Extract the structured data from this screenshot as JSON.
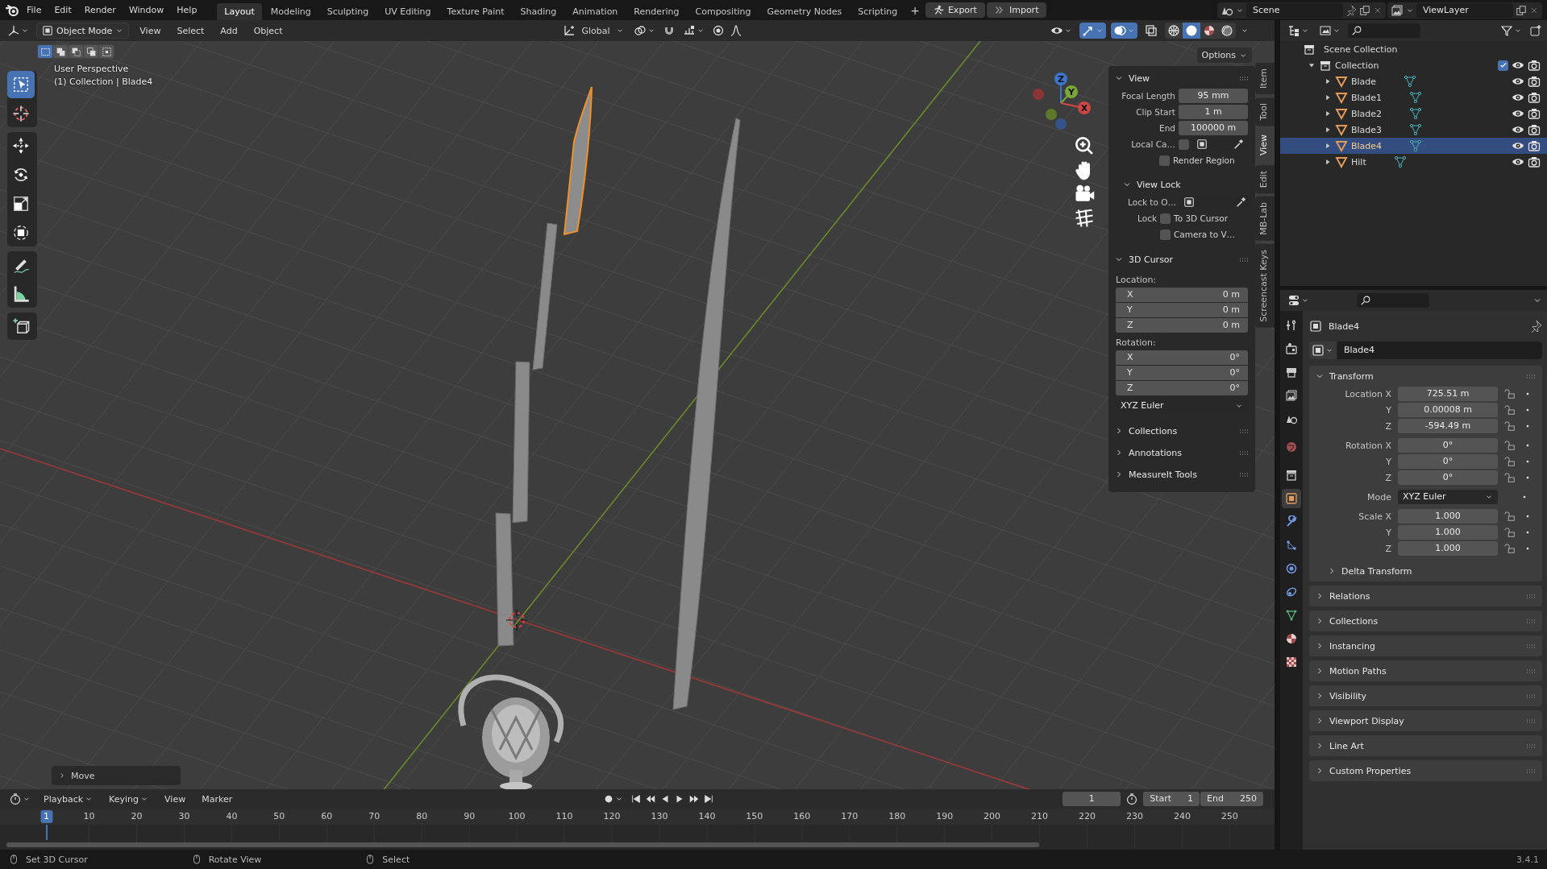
{
  "topbar": {
    "menus": [
      "File",
      "Edit",
      "Render",
      "Window",
      "Help"
    ],
    "workspaces": [
      {
        "label": "Layout",
        "selected": true
      },
      {
        "label": "Modeling",
        "selected": false
      },
      {
        "label": "Sculpting",
        "selected": false
      },
      {
        "label": "UV Editing",
        "selected": false
      },
      {
        "label": "Texture Paint",
        "selected": false
      },
      {
        "label": "Shading",
        "selected": false
      },
      {
        "label": "Animation",
        "selected": false
      },
      {
        "label": "Rendering",
        "selected": false
      },
      {
        "label": "Compositing",
        "selected": false
      },
      {
        "label": "Geometry Nodes",
        "selected": false
      },
      {
        "label": "Scripting",
        "selected": false
      }
    ],
    "add_tab": "+",
    "addon_buttons": [
      "Export",
      "Import"
    ],
    "scene": "Scene",
    "view_layer": "ViewLayer"
  },
  "viewport_header": {
    "mode": "Object Mode",
    "menus": [
      "View",
      "Select",
      "Add",
      "Object"
    ],
    "orientation": "Global",
    "toggles": [
      {
        "kind": "visibility",
        "on": false
      },
      {
        "kind": "gizmo",
        "on": true
      },
      {
        "kind": "overlay",
        "on": true
      },
      {
        "kind": "xray",
        "on": false
      }
    ],
    "shading": [
      {
        "kind": "wireframe",
        "selected": false
      },
      {
        "kind": "solid",
        "selected": true
      },
      {
        "kind": "material",
        "selected": false
      },
      {
        "kind": "rendered",
        "selected": false
      }
    ],
    "select_modes": [
      {
        "kind": "new",
        "selected": true
      },
      {
        "kind": "extend",
        "selected": false
      },
      {
        "kind": "subtract",
        "selected": false
      },
      {
        "kind": "invert",
        "selected": false
      },
      {
        "kind": "intersect",
        "selected": false
      }
    ],
    "options": "Options"
  },
  "viewport": {
    "perspective": "User Perspective",
    "context": "(1) Collection | Blade4",
    "tool_groups": [
      [
        {
          "kind": "select",
          "selected": true
        },
        {
          "kind": "cursor",
          "selected": false
        }
      ],
      [
        {
          "kind": "move",
          "selected": false
        },
        {
          "kind": "rotate",
          "selected": false
        },
        {
          "kind": "scale",
          "selected": false
        },
        {
          "kind": "transform",
          "selected": false
        }
      ],
      [
        {
          "kind": "annotate",
          "selected": false
        },
        {
          "kind": "measure",
          "selected": false
        }
      ],
      [
        {
          "kind": "add_cube",
          "selected": false
        }
      ]
    ],
    "gizmo_axes": [
      "Z",
      "Y",
      "X"
    ],
    "last_operator": "Move"
  },
  "sidebar": {
    "tabs": [
      {
        "label": "Item",
        "selected": false
      },
      {
        "label": "Tool",
        "selected": false
      },
      {
        "label": "View",
        "selected": true
      },
      {
        "label": "Edit",
        "selected": false
      },
      {
        "label": "MB-Lab",
        "selected": false
      },
      {
        "label": "Screencast Keys",
        "selected": false
      }
    ],
    "panels": [
      {
        "title": "View",
        "expanded": true,
        "rows": [
          {
            "kind": "field",
            "label": "Focal Length",
            "value": "95 mm"
          },
          {
            "kind": "field",
            "label": "Clip Start",
            "value": "1 m"
          },
          {
            "kind": "field",
            "label": "End",
            "value": "100000 m"
          },
          {
            "kind": "picker",
            "label": "Local Ca…",
            "checked": false
          },
          {
            "kind": "checkbox",
            "label": "Render Region",
            "checked": false
          }
        ],
        "subpanels": [
          {
            "title": "View Lock",
            "expanded": true,
            "rows": [
              {
                "kind": "picker",
                "label": "Lock to O…"
              },
              {
                "kind": "checkbox",
                "prefix": "Lock",
                "label": "To 3D Cursor",
                "checked": false
              },
              {
                "kind": "checkbox",
                "label": "Camera to V…",
                "checked": false
              }
            ]
          }
        ]
      },
      {
        "title": "3D Cursor",
        "expanded": true,
        "rows": [
          {
            "kind": "heading",
            "text": "Location:"
          },
          {
            "kind": "vector",
            "items": [
              {
                "axis": "X",
                "value": "0 m"
              },
              {
                "axis": "Y",
                "value": "0 m"
              },
              {
                "axis": "Z",
                "value": "0 m"
              }
            ]
          },
          {
            "kind": "heading",
            "text": "Rotation:"
          },
          {
            "kind": "vector",
            "items": [
              {
                "axis": "X",
                "value": "0°"
              },
              {
                "axis": "Y",
                "value": "0°"
              },
              {
                "axis": "Z",
                "value": "0°"
              }
            ]
          },
          {
            "kind": "dropdown",
            "value": "XYZ Euler"
          }
        ]
      },
      {
        "title": "Collections",
        "expanded": false
      },
      {
        "title": "Annotations",
        "expanded": false
      },
      {
        "title": "MeasureIt Tools",
        "expanded": false
      }
    ]
  },
  "outliner": {
    "root": "Scene Collection",
    "children": [
      {
        "name": "Collection",
        "expanded": true,
        "checked": true,
        "children": [
          {
            "name": "Blade",
            "selected": false
          },
          {
            "name": "Blade1",
            "selected": false
          },
          {
            "name": "Blade2",
            "selected": false
          },
          {
            "name": "Blade3",
            "selected": false
          },
          {
            "name": "Blade4",
            "selected": true
          },
          {
            "name": "Hilt",
            "selected": false
          }
        ]
      }
    ]
  },
  "properties": {
    "tabs": [
      {
        "kind": "tool",
        "selected": false
      },
      {
        "kind": "render",
        "selected": false
      },
      {
        "kind": "output",
        "selected": false
      },
      {
        "kind": "view_layer",
        "selected": false
      },
      {
        "kind": "scene",
        "selected": false
      },
      {
        "kind": "world",
        "selected": false
      },
      {
        "kind": "collection",
        "selected": false
      },
      {
        "kind": "object",
        "selected": true
      },
      {
        "kind": "modifiers",
        "selected": false
      },
      {
        "kind": "particles",
        "selected": false
      },
      {
        "kind": "physics",
        "selected": false
      },
      {
        "kind": "constraints",
        "selected": false
      },
      {
        "kind": "data",
        "selected": false
      },
      {
        "kind": "material",
        "selected": false
      },
      {
        "kind": "texture",
        "selected": false
      }
    ],
    "object_name": "Blade4",
    "datablock": "Blade4",
    "transform": {
      "title": "Transform",
      "expanded": true,
      "groups": [
        [
          {
            "kind": "field",
            "label": "Location X",
            "value": "725.51 m"
          },
          {
            "kind": "field",
            "label": "Y",
            "value": "0.00008 m"
          },
          {
            "kind": "field",
            "label": "Z",
            "value": "-594.49 m"
          }
        ],
        [
          {
            "kind": "field",
            "label": "Rotation X",
            "value": "0°"
          },
          {
            "kind": "field",
            "label": "Y",
            "value": "0°"
          },
          {
            "kind": "field",
            "label": "Z",
            "value": "0°"
          }
        ],
        [
          {
            "kind": "dropdown",
            "label": "Mode",
            "value": "XYZ Euler"
          }
        ],
        [
          {
            "kind": "field",
            "label": "Scale X",
            "value": "1.000"
          },
          {
            "kind": "field",
            "label": "Y",
            "value": "1.000"
          },
          {
            "kind": "field",
            "label": "Z",
            "value": "1.000"
          }
        ]
      ],
      "subpanels": [
        {
          "title": "Delta Transform",
          "expanded": false
        }
      ]
    },
    "panels": [
      {
        "title": "Relations",
        "expanded": false
      },
      {
        "title": "Collections",
        "expanded": false
      },
      {
        "title": "Instancing",
        "expanded": false
      },
      {
        "title": "Motion Paths",
        "expanded": false
      },
      {
        "title": "Visibility",
        "expanded": false
      },
      {
        "title": "Viewport Display",
        "expanded": false
      },
      {
        "title": "Line Art",
        "expanded": false
      },
      {
        "title": "Custom Properties",
        "expanded": false
      }
    ]
  },
  "timeline": {
    "menus": [
      "Playback",
      "Keying",
      "View",
      "Marker"
    ],
    "current_frame": "1",
    "start_label": "Start",
    "start": "1",
    "end_label": "End",
    "end": "250",
    "ruler": [
      {
        "label": "1",
        "selected": true
      },
      {
        "label": "10",
        "selected": false
      },
      {
        "label": "20",
        "selected": false
      },
      {
        "label": "30",
        "selected": false
      },
      {
        "label": "40",
        "selected": false
      },
      {
        "label": "50",
        "selected": false
      },
      {
        "label": "60",
        "selected": false
      },
      {
        "label": "70",
        "selected": false
      },
      {
        "label": "80",
        "selected": false
      },
      {
        "label": "90",
        "selected": false
      },
      {
        "label": "100",
        "selected": false
      },
      {
        "label": "110",
        "selected": false
      },
      {
        "label": "120",
        "selected": false
      },
      {
        "label": "130",
        "selected": false
      },
      {
        "label": "140",
        "selected": false
      },
      {
        "label": "150",
        "selected": false
      },
      {
        "label": "160",
        "selected": false
      },
      {
        "label": "170",
        "selected": false
      },
      {
        "label": "180",
        "selected": false
      },
      {
        "label": "190",
        "selected": false
      },
      {
        "label": "200",
        "selected": false
      },
      {
        "label": "210",
        "selected": false
      },
      {
        "label": "220",
        "selected": false
      },
      {
        "label": "230",
        "selected": false
      },
      {
        "label": "240",
        "selected": false
      },
      {
        "label": "250",
        "selected": false
      }
    ]
  },
  "status_bar": {
    "hints": [
      "Set 3D Cursor",
      "Rotate View",
      "Select"
    ],
    "version": "3.4.1"
  }
}
